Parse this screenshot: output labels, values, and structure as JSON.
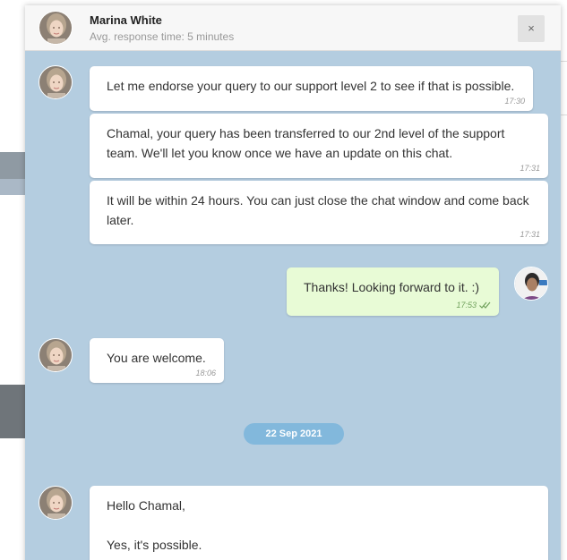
{
  "header": {
    "agent_name": "Marina White",
    "status": "Avg. response time: 5 minutes",
    "close_label": "×"
  },
  "messages": [
    {
      "text": "Let me endorse your query to our support level 2 to see if that is possible.",
      "time": "17:30"
    },
    {
      "text": "Chamal, your query has been transferred to our 2nd level of the support team. We'll let you know once we have an update on this chat.",
      "time": "17:31"
    },
    {
      "text": "It will be within 24 hours. You can just close the chat window and come back later.",
      "time": "17:31"
    },
    {
      "text": "Thanks! Looking forward to it. :)",
      "time": "17:53"
    },
    {
      "text": "You are welcome.",
      "time": "18:06"
    },
    {
      "line1": "Hello Chamal,",
      "line2": "Yes, it's possible."
    }
  ],
  "date_separator": "22 Sep 2021",
  "colors": {
    "chat_background": "#b4cde0",
    "outgoing_bubble": "#e8fbd6",
    "date_pill": "#82b8dc"
  },
  "icons": {
    "agent_avatar": "agent-avatar",
    "user_avatar": "user-avatar",
    "read_receipt": "double-check-icon"
  }
}
